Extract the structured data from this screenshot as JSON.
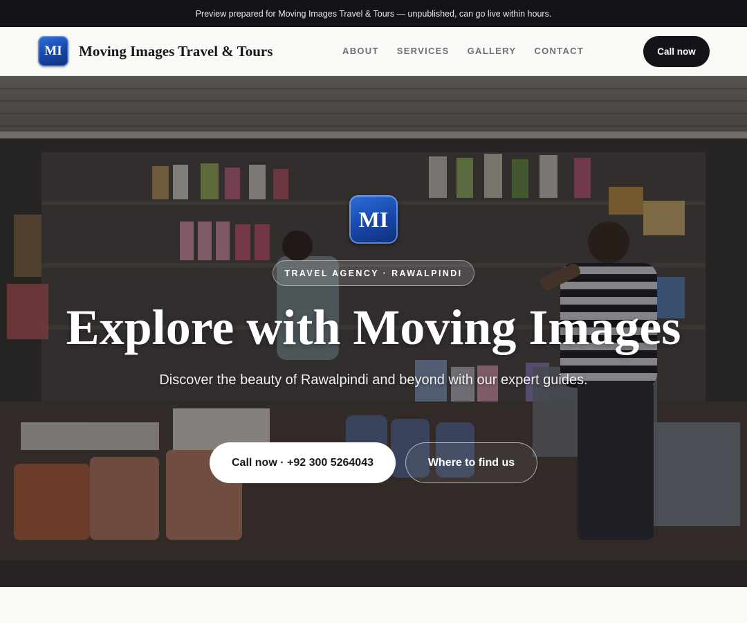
{
  "banner": {
    "text": "Preview prepared for Moving Images Travel & Tours — unpublished, can go live within hours."
  },
  "header": {
    "logo_text": "MI",
    "brand_name": "Moving Images Travel & Tours",
    "nav": [
      "ABOUT",
      "SERVICES",
      "GALLERY",
      "CONTACT"
    ],
    "call_label": "Call now"
  },
  "hero": {
    "logo_text": "MI",
    "tag": "TRAVEL AGENCY · RAWALPINDI",
    "title": "Explore with Moving Images",
    "subtitle": "Discover the beauty of Rawalpindi and beyond with our expert guides.",
    "primary_button": "Call now · +92 300 5264043",
    "secondary_button": "Where to find us"
  },
  "colors": {
    "banner_bg": "#121419",
    "accent_dark": "#121419",
    "logo_blue": "#1746a8",
    "page_bg": "#faf9f6"
  }
}
